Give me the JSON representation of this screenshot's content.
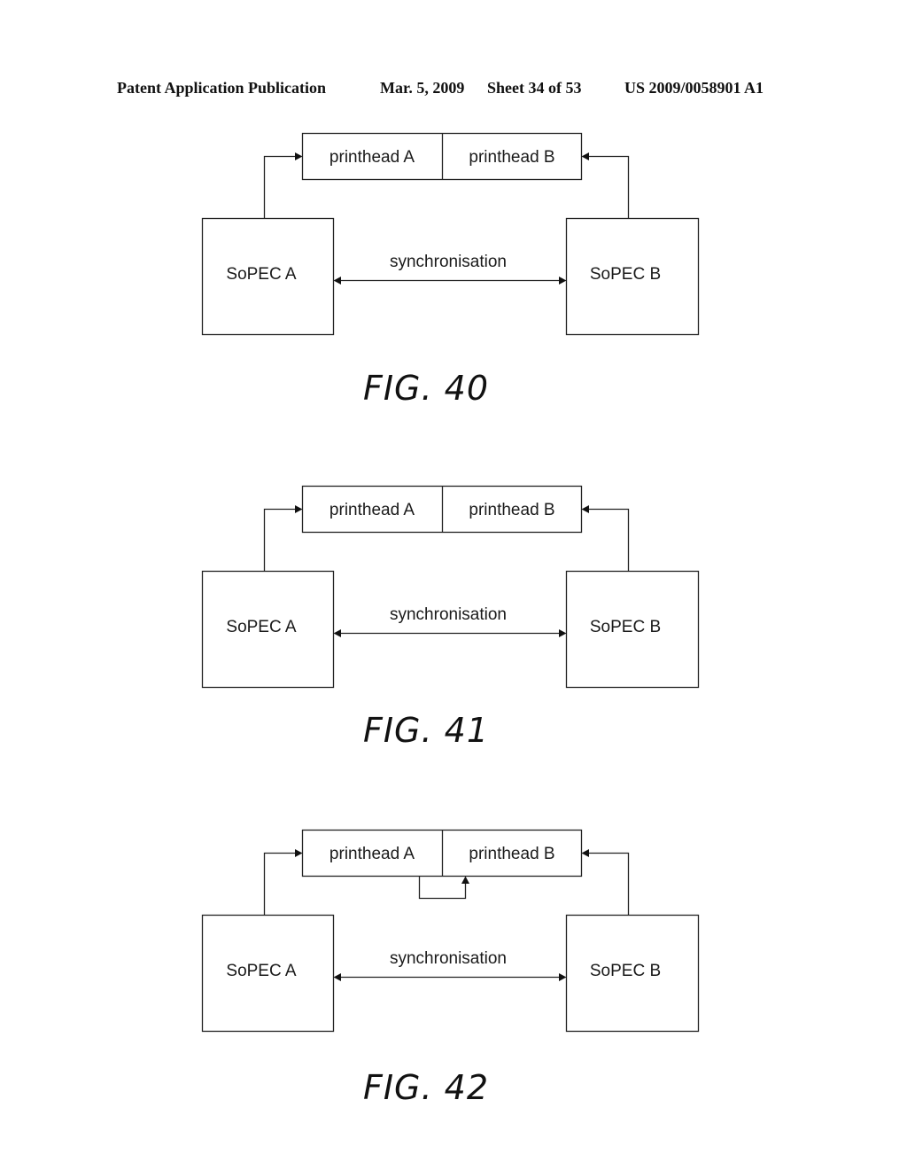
{
  "header": {
    "publication": "Patent Application Publication",
    "date": "Mar. 5, 2009",
    "sheet": "Sheet 34 of 53",
    "number": "US 2009/0058901 A1"
  },
  "figures": [
    {
      "caption": "FIG. 40",
      "printhead_a": "printhead A",
      "printhead_b": "printhead B",
      "sopec_a": "SoPEC A",
      "sopec_b": "SoPEC B",
      "link_label": "synchronisation",
      "has_printhead_link": false
    },
    {
      "caption": "FIG. 41",
      "printhead_a": "printhead A",
      "printhead_b": "printhead B",
      "sopec_a": "SoPEC A",
      "sopec_b": "SoPEC B",
      "link_label": "synchronisation",
      "has_printhead_link": false
    },
    {
      "caption": "FIG. 42",
      "printhead_a": "printhead A",
      "printhead_b": "printhead B",
      "sopec_a": "SoPEC A",
      "sopec_b": "SoPEC B",
      "link_label": "synchronisation",
      "has_printhead_link": true
    }
  ]
}
